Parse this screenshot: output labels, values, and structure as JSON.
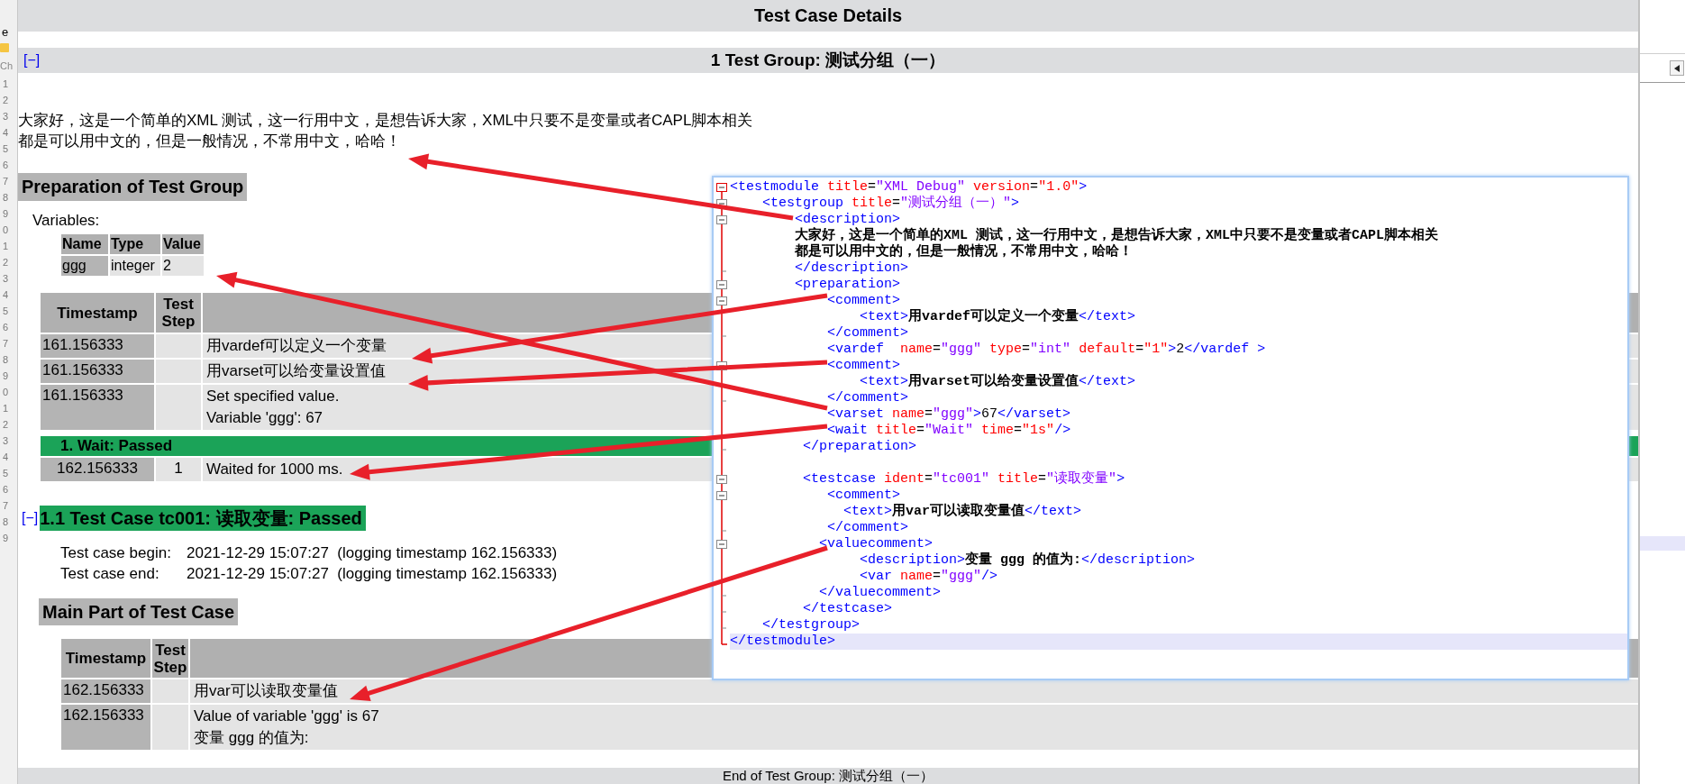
{
  "left_edge": {
    "texts": [
      "e",
      "Ch"
    ],
    "line_numbers": [
      "1",
      "2",
      "3",
      "4",
      "5",
      "6",
      "7",
      "8",
      "9",
      "0",
      "1",
      "2",
      "3",
      "4",
      "5",
      "6",
      "7",
      "8",
      "9",
      "0",
      "1",
      "2",
      "3",
      "4",
      "5",
      "6",
      "7",
      "8",
      "9"
    ]
  },
  "report": {
    "title": "Test Case Details",
    "group": {
      "toggle": "[−]",
      "title": "1 Test Group: 测试分组（一）",
      "description": [
        "大家好，这是一个简单的XML 测试，这一行用中文，是想告诉大家，XML中只要不是变量或者CAPL脚本相关",
        "都是可以用中文的，但是一般情况，不常用中文，哈哈！"
      ]
    },
    "preparation": {
      "heading": "Preparation of Test Group",
      "variables_label": "Variables:",
      "variables_table": {
        "columns": [
          "Name",
          "Type",
          "Value"
        ],
        "rows": [
          [
            "ggg",
            "integer",
            "2"
          ]
        ]
      },
      "steps_table": {
        "columns": [
          "Timestamp",
          "Test Step"
        ],
        "rows": [
          {
            "kind": "step",
            "timestamp": "161.156333",
            "lines": [
              "用vardef可以定义一个变量"
            ]
          },
          {
            "kind": "step",
            "timestamp": "161.156333",
            "lines": [
              "用varset可以给变量设置值"
            ]
          },
          {
            "kind": "step",
            "timestamp": "161.156333",
            "lines": [
              "Set specified value.",
              "Variable 'ggg': 67"
            ]
          },
          {
            "kind": "verdict",
            "title": "1. Wait: Passed",
            "passed": true
          },
          {
            "kind": "verdict_step",
            "timestamp": "162.156333",
            "step": "1",
            "lines": [
              "Waited for 1000 ms."
            ]
          }
        ]
      }
    },
    "test_case": {
      "toggle": "[−]",
      "title": "1.1 Test Case tc001: 读取变量: Passed",
      "passed": true,
      "info": [
        {
          "label": "Test case begin:",
          "value": "2021-12-29 15:07:27  (logging timestamp 162.156333)"
        },
        {
          "label": "Test case end:",
          "value": "2021-12-29 15:07:27  (logging timestamp 162.156333)"
        }
      ],
      "main_heading": "Main Part of Test Case",
      "table": {
        "columns": [
          "Timestamp",
          "Test Step"
        ],
        "rows": [
          {
            "kind": "step",
            "timestamp": "162.156333",
            "lines": [
              "用var可以读取变量值"
            ]
          },
          {
            "kind": "step",
            "timestamp": "162.156333",
            "lines": [
              "Value of variable 'ggg' is 67",
              "变量 ggg 的值为:"
            ]
          }
        ]
      }
    },
    "footer": "End of Test Group: 测试分组（一）"
  },
  "code_panel": {
    "lines": [
      {
        "kind": "fold_start",
        "highlighted": false,
        "tokens": [
          {
            "kind": "tag",
            "text": "<testmodule"
          },
          {
            "kind": "attr",
            "text": " title"
          },
          {
            "kind": "plain",
            "text": "="
          },
          {
            "kind": "value",
            "text": "\"XML Debug\""
          },
          {
            "kind": "attr",
            "text": " version"
          },
          {
            "kind": "plain",
            "text": "="
          },
          {
            "kind": "number",
            "text": "\"1.0\""
          },
          {
            "kind": "tag",
            "text": ">"
          }
        ]
      },
      {
        "kind": "fold_open",
        "highlighted": false,
        "tokens": [
          {
            "kind": "tag",
            "text": "    <testgroup"
          },
          {
            "kind": "attr",
            "text": " title"
          },
          {
            "kind": "plain",
            "text": "="
          },
          {
            "kind": "value",
            "text": "\"测试分组（一）\""
          },
          {
            "kind": "tag",
            "text": ">"
          }
        ]
      },
      {
        "kind": "fold_open",
        "highlighted": false,
        "tokens": [
          {
            "kind": "tag",
            "text": "        <description>"
          }
        ]
      },
      {
        "kind": "fold_inner",
        "highlighted": false,
        "tokens": [
          {
            "kind": "content",
            "text": "        大家好，这是一个简单的XML 测试，这一行用中文，是想告诉大家，XML中只要不是变量或者CAPL脚本相关"
          }
        ]
      },
      {
        "kind": "fold_inner",
        "highlighted": false,
        "tokens": [
          {
            "kind": "content",
            "text": "        都是可以用中文的，但是一般情况，不常用中文，哈哈！"
          }
        ]
      },
      {
        "kind": "fold_close",
        "highlighted": false,
        "tokens": [
          {
            "kind": "tag",
            "text": "        </description>"
          }
        ]
      },
      {
        "kind": "fold_open",
        "highlighted": false,
        "tokens": [
          {
            "kind": "tag",
            "text": "        <preparation>"
          }
        ]
      },
      {
        "kind": "fold_open",
        "highlighted": false,
        "tokens": [
          {
            "kind": "tag",
            "text": "            <comment>"
          }
        ]
      },
      {
        "kind": "fold_inner",
        "highlighted": false,
        "tokens": [
          {
            "kind": "tag",
            "text": "                <text>"
          },
          {
            "kind": "content",
            "text": "用vardef可以定义一个变量"
          },
          {
            "kind": "tag",
            "text": "</text>"
          }
        ]
      },
      {
        "kind": "fold_close",
        "highlighted": false,
        "tokens": [
          {
            "kind": "tag",
            "text": "            </comment>"
          }
        ]
      },
      {
        "kind": "fold_inner",
        "highlighted": false,
        "tokens": [
          {
            "kind": "tag",
            "text": "            <vardef"
          },
          {
            "kind": "attr",
            "text": "  name"
          },
          {
            "kind": "plain",
            "text": "="
          },
          {
            "kind": "value",
            "text": "\"ggg\""
          },
          {
            "kind": "attr",
            "text": " type"
          },
          {
            "kind": "plain",
            "text": "="
          },
          {
            "kind": "value",
            "text": "\"int\""
          },
          {
            "kind": "attr",
            "text": " default"
          },
          {
            "kind": "plain",
            "text": "="
          },
          {
            "kind": "number",
            "text": "\"1\""
          },
          {
            "kind": "tag",
            "text": ">"
          },
          {
            "kind": "plain",
            "text": "2"
          },
          {
            "kind": "tag",
            "text": "</vardef >"
          }
        ]
      },
      {
        "kind": "fold_open",
        "highlighted": false,
        "tokens": [
          {
            "kind": "tag",
            "text": "            <comment>"
          }
        ]
      },
      {
        "kind": "fold_inner",
        "highlighted": false,
        "tokens": [
          {
            "kind": "tag",
            "text": "                <text>"
          },
          {
            "kind": "content",
            "text": "用varset可以给变量设置值"
          },
          {
            "kind": "tag",
            "text": "</text>"
          }
        ]
      },
      {
        "kind": "fold_close",
        "highlighted": false,
        "tokens": [
          {
            "kind": "tag",
            "text": "            </comment>"
          }
        ]
      },
      {
        "kind": "fold_inner",
        "highlighted": false,
        "tokens": [
          {
            "kind": "tag",
            "text": "            <varset"
          },
          {
            "kind": "attr",
            "text": " name"
          },
          {
            "kind": "plain",
            "text": "="
          },
          {
            "kind": "value",
            "text": "\"ggg\""
          },
          {
            "kind": "tag",
            "text": ">"
          },
          {
            "kind": "plain",
            "text": "67"
          },
          {
            "kind": "tag",
            "text": "</varset>"
          }
        ]
      },
      {
        "kind": "fold_inner",
        "highlighted": false,
        "tokens": [
          {
            "kind": "tag",
            "text": "            <wait"
          },
          {
            "kind": "attr",
            "text": " title"
          },
          {
            "kind": "plain",
            "text": "="
          },
          {
            "kind": "value",
            "text": "\"Wait\""
          },
          {
            "kind": "attr",
            "text": " time"
          },
          {
            "kind": "plain",
            "text": "="
          },
          {
            "kind": "number",
            "text": "\"1s\""
          },
          {
            "kind": "tag",
            "text": "/>"
          }
        ]
      },
      {
        "kind": "fold_close",
        "highlighted": false,
        "tokens": [
          {
            "kind": "tag",
            "text": "         </preparation>"
          }
        ]
      },
      {
        "kind": "fold_inner",
        "highlighted": false
      },
      {
        "kind": "fold_open",
        "highlighted": false,
        "tokens": [
          {
            "kind": "tag",
            "text": "         <testcase"
          },
          {
            "kind": "attr",
            "text": " ident"
          },
          {
            "kind": "plain",
            "text": "="
          },
          {
            "kind": "value",
            "text": "\"tc001\""
          },
          {
            "kind": "attr",
            "text": " title"
          },
          {
            "kind": "plain",
            "text": "="
          },
          {
            "kind": "value",
            "text": "\"读取变量\""
          },
          {
            "kind": "tag",
            "text": ">"
          }
        ]
      },
      {
        "kind": "fold_open",
        "highlighted": false,
        "tokens": [
          {
            "kind": "tag",
            "text": "            <comment>"
          }
        ]
      },
      {
        "kind": "fold_inner",
        "highlighted": false,
        "tokens": [
          {
            "kind": "tag",
            "text": "              <text>"
          },
          {
            "kind": "content",
            "text": "用var可以读取变量值"
          },
          {
            "kind": "tag",
            "text": "</text>"
          }
        ]
      },
      {
        "kind": "fold_close",
        "highlighted": false,
        "tokens": [
          {
            "kind": "tag",
            "text": "            </comment>"
          }
        ]
      },
      {
        "kind": "fold_open",
        "highlighted": false,
        "tokens": [
          {
            "kind": "tag",
            "text": "           <valuecomment>"
          }
        ]
      },
      {
        "kind": "fold_inner",
        "highlighted": false,
        "tokens": [
          {
            "kind": "tag",
            "text": "                <description>"
          },
          {
            "kind": "content",
            "text": "变量 ggg 的值为:"
          },
          {
            "kind": "tag",
            "text": "</description>"
          }
        ]
      },
      {
        "kind": "fold_inner",
        "highlighted": false,
        "tokens": [
          {
            "kind": "tag",
            "text": "                <var"
          },
          {
            "kind": "attr",
            "text": " name"
          },
          {
            "kind": "plain",
            "text": "="
          },
          {
            "kind": "value",
            "text": "\"ggg\""
          },
          {
            "kind": "tag",
            "text": "/>"
          }
        ]
      },
      {
        "kind": "fold_close",
        "highlighted": false,
        "tokens": [
          {
            "kind": "tag",
            "text": "           </valuecomment>"
          }
        ]
      },
      {
        "kind": "fold_close",
        "highlighted": false,
        "tokens": [
          {
            "kind": "tag",
            "text": "         </testcase>"
          }
        ]
      },
      {
        "kind": "fold_close",
        "highlighted": false,
        "tokens": [
          {
            "kind": "tag",
            "text": "    </testgroup>"
          }
        ]
      },
      {
        "kind": "fold_end",
        "highlighted": true,
        "tokens": [
          {
            "kind": "tag",
            "text": "</testmodule>"
          }
        ]
      }
    ]
  }
}
